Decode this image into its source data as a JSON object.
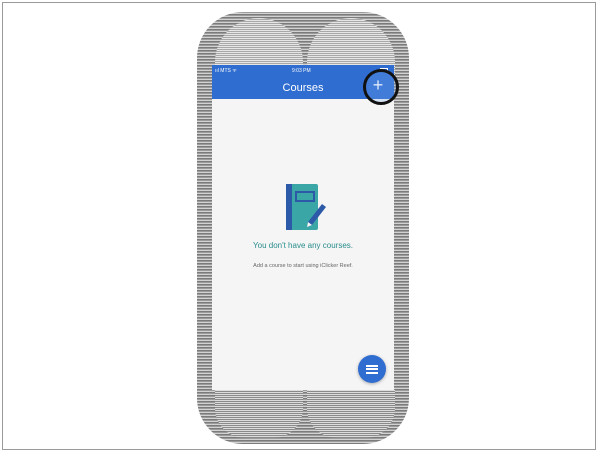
{
  "status_bar": {
    "carrier": "ııl MTS ᯤ",
    "time": "9:03 PM"
  },
  "header": {
    "title": "Courses",
    "add_label": "+"
  },
  "empty_state": {
    "title": "You don't have any courses.",
    "subtitle": "Add a course to start using iClicker Reef.",
    "icon": "notebook-pencil-icon"
  },
  "fab": {
    "icon": "menu-icon"
  },
  "colors": {
    "primary": "#2f6dd0",
    "teal_text": "#2a8c8c",
    "notebook": "#3aa6a6",
    "notebook_spine": "#2d5aa8"
  }
}
